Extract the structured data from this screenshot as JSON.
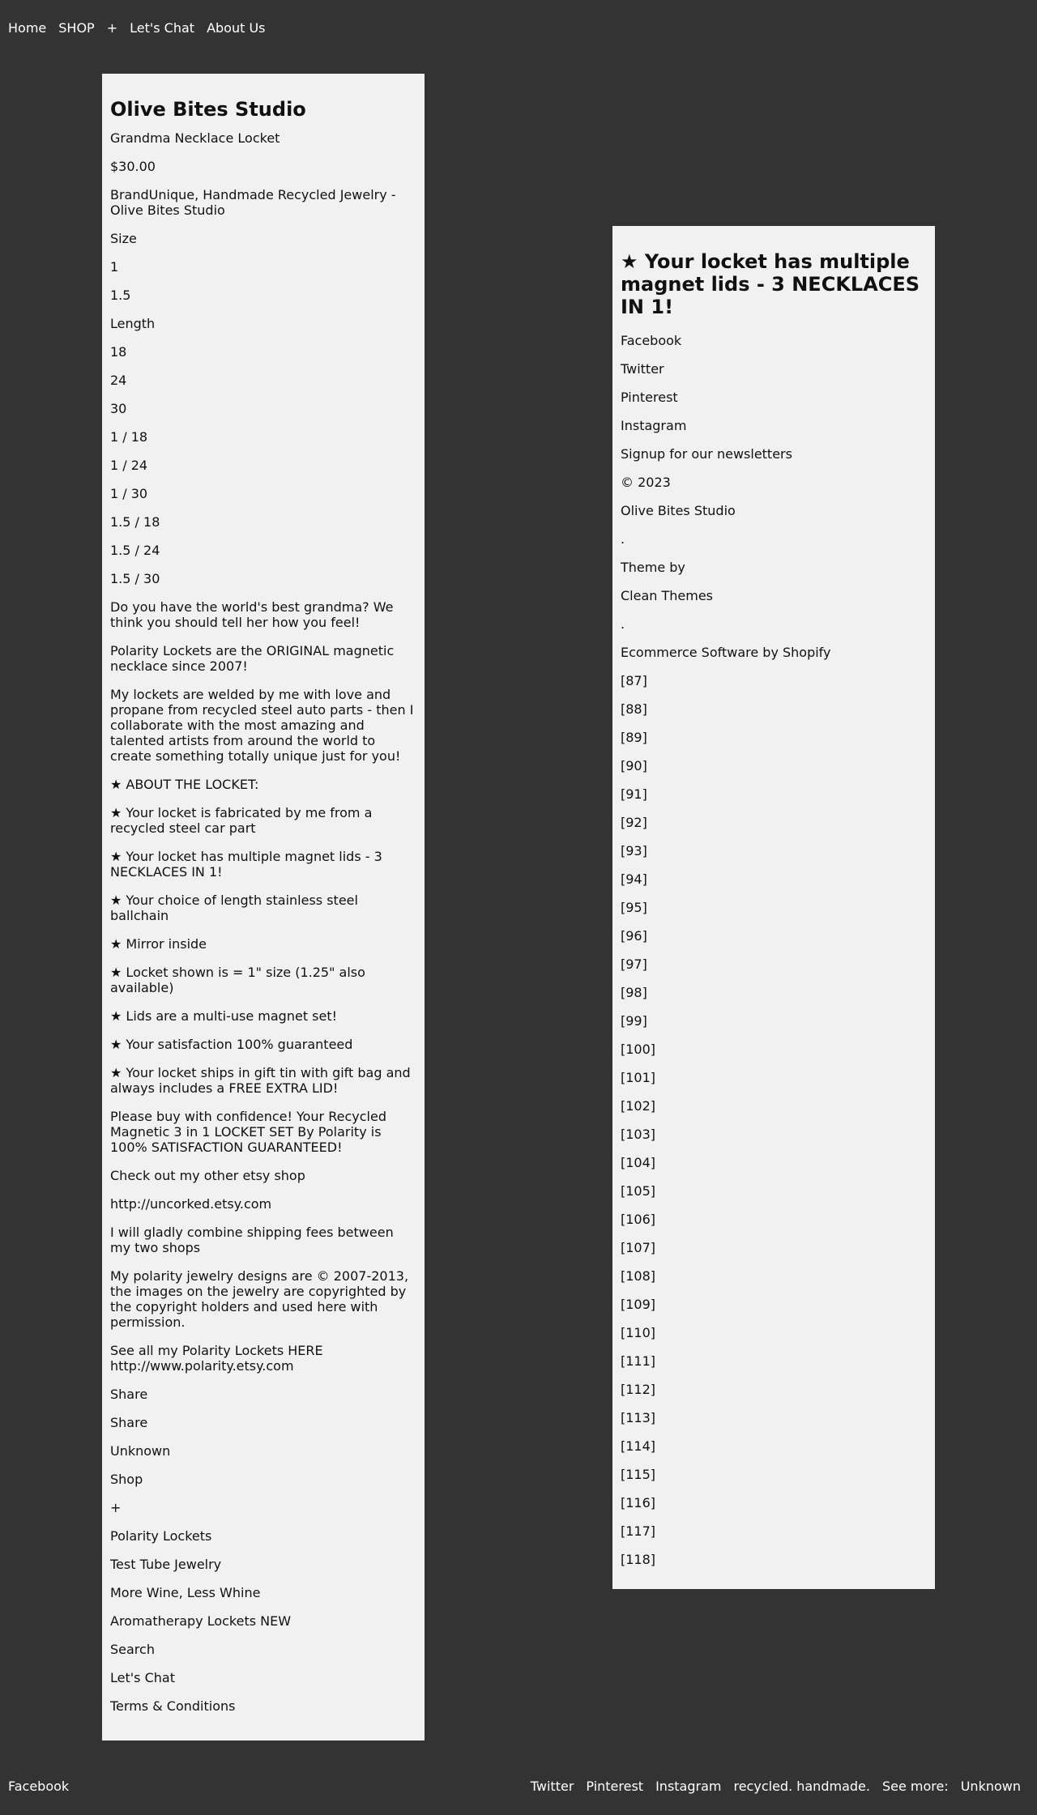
{
  "nav": {
    "items": [
      "Home",
      "SHOP",
      "+",
      "Let's Chat",
      "About Us"
    ]
  },
  "left": {
    "title": "Olive Bites Studio",
    "product_name": "Grandma Necklace Locket",
    "price": "$30.00",
    "brand": "BrandUnique, Handmade Recycled Jewelry - Olive Bites Studio",
    "size_label": "Size",
    "sizes": [
      "1",
      "1.5"
    ],
    "length_label": "Length",
    "lengths": [
      "18",
      "24",
      "30"
    ],
    "variants": [
      "1 / 18",
      "1 / 24",
      "1 / 30",
      "1.5 / 18",
      "1.5 / 24",
      "1.5 / 30"
    ],
    "description": [
      "Do you have the world's best grandma? We think you should tell her how you feel!",
      "Polarity Lockets are the ORIGINAL magnetic necklace since 2007!",
      "My lockets are welded by me with love and propane from recycled steel auto parts - then I collaborate with the most amazing and talented artists from around the world to create something totally unique just for you!",
      "★ ABOUT THE LOCKET:",
      "★ Your locket is fabricated by me from a recycled steel car part",
      "★ Your locket has multiple magnet lids - 3 NECKLACES IN 1!",
      "★ Your choice of length stainless steel ballchain",
      "★ Mirror inside",
      "★ Locket shown is = 1\" size (1.25\" also available)",
      "★ Lids are a multi-use magnet set!",
      "★ Your satisfaction 100% guaranteed",
      "★ Your locket ships in gift tin with gift bag and always includes a FREE EXTRA LID!",
      "Please buy with confidence! Your Recycled Magnetic 3 in 1 LOCKET SET By Polarity is 100% SATISFACTION GUARANTEED!",
      "Check out my other etsy shop",
      "http://uncorked.etsy.com",
      "I will gladly combine shipping fees between my two shops",
      "My polarity jewelry designs are © 2007-2013, the images on the jewelry are copyrighted by the copyright holders and used here with permission.",
      "See all my Polarity Lockets HERE http://www.polarity.etsy.com"
    ],
    "share_1": "Share",
    "share_2": "Share",
    "unknown": "Unknown",
    "shop": "Shop",
    "plus": "+",
    "menu": [
      "Polarity Lockets",
      "Test Tube Jewelry",
      "More Wine, Less Whine",
      "Aromatherapy Lockets NEW",
      "Search",
      "Let's Chat",
      "Terms & Conditions"
    ]
  },
  "right": {
    "title": "★ Your locket has multiple magnet lids - 3 NECKLACES IN 1!",
    "social": [
      "Facebook",
      "Twitter",
      "Pinterest",
      "Instagram"
    ],
    "newsletter": "Signup for our newsletters",
    "copyright": "© 2023",
    "studio": "Olive Bites Studio",
    "dot1": ".",
    "theme_by": "Theme by",
    "clean_themes": "Clean Themes",
    "dot2": ".",
    "ecommerce": "Ecommerce Software by Shopify",
    "refs": [
      "[87]",
      "[88]",
      "[89]",
      "[90]",
      "[91]",
      "[92]",
      "[93]",
      "[94]",
      "[95]",
      "[96]",
      "[97]",
      "[98]",
      "[99]",
      "[100]",
      "[101]",
      "[102]",
      "[103]",
      "[104]",
      "[105]",
      "[106]",
      "[107]",
      "[108]",
      "[109]",
      "[110]",
      "[111]",
      "[112]",
      "[113]",
      "[114]",
      "[115]",
      "[116]",
      "[117]",
      "[118]"
    ]
  },
  "footer": {
    "facebook": "Facebook",
    "links": [
      "Twitter",
      "Pinterest",
      "Instagram",
      "recycled. handmade.",
      "See more:",
      "Unknown"
    ]
  }
}
